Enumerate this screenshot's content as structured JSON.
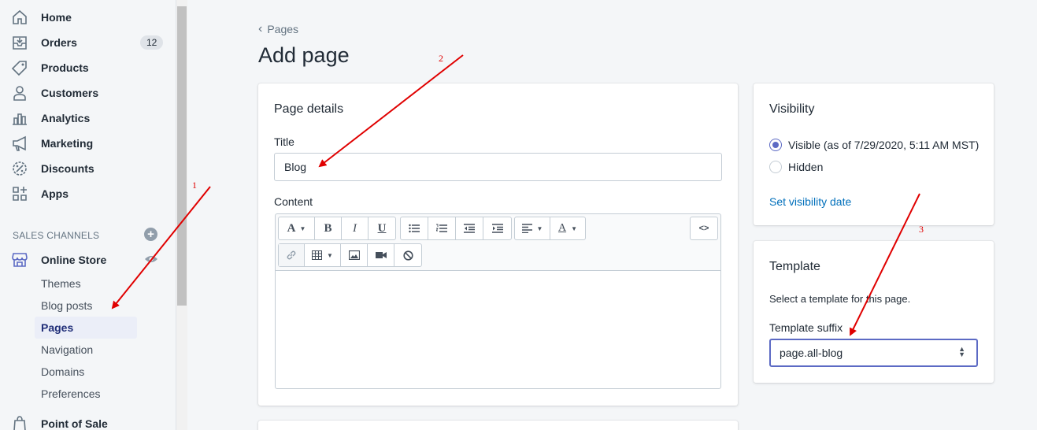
{
  "sidebar": {
    "items": [
      {
        "label": "Home",
        "icon": "home-icon"
      },
      {
        "label": "Orders",
        "icon": "orders-icon",
        "badge": "12"
      },
      {
        "label": "Products",
        "icon": "tag-icon"
      },
      {
        "label": "Customers",
        "icon": "person-icon"
      },
      {
        "label": "Analytics",
        "icon": "bar-chart-icon"
      },
      {
        "label": "Marketing",
        "icon": "megaphone-icon"
      },
      {
        "label": "Discounts",
        "icon": "discount-icon"
      },
      {
        "label": "Apps",
        "icon": "apps-icon"
      }
    ],
    "section_header": "SALES CHANNELS",
    "online_store": "Online Store",
    "sub_items": [
      "Themes",
      "Blog posts",
      "Pages",
      "Navigation",
      "Domains",
      "Preferences"
    ],
    "active_sub_item": "Pages",
    "point_of_sale": "Point of Sale"
  },
  "breadcrumb": "Pages",
  "page_title": "Add page",
  "page_details": {
    "title": "Page details",
    "title_label": "Title",
    "title_value": "Blog",
    "content_label": "Content",
    "toolbar": {
      "html_btn": "<>"
    }
  },
  "visibility": {
    "title": "Visibility",
    "visible_label": "Visible (as of 7/29/2020, 5:11 AM MST)",
    "hidden_label": "Hidden",
    "selected": "visible",
    "set_date_link": "Set visibility date"
  },
  "template": {
    "title": "Template",
    "description": "Select a template for this page.",
    "suffix_label": "Template suffix",
    "suffix_value": "page.all-blog"
  },
  "annotations": [
    "1",
    "2",
    "3"
  ],
  "colors": {
    "accent": "#5c6ac4",
    "link": "#006fbb",
    "annotation": "#e00000",
    "active_bg": "#ebeef8"
  }
}
